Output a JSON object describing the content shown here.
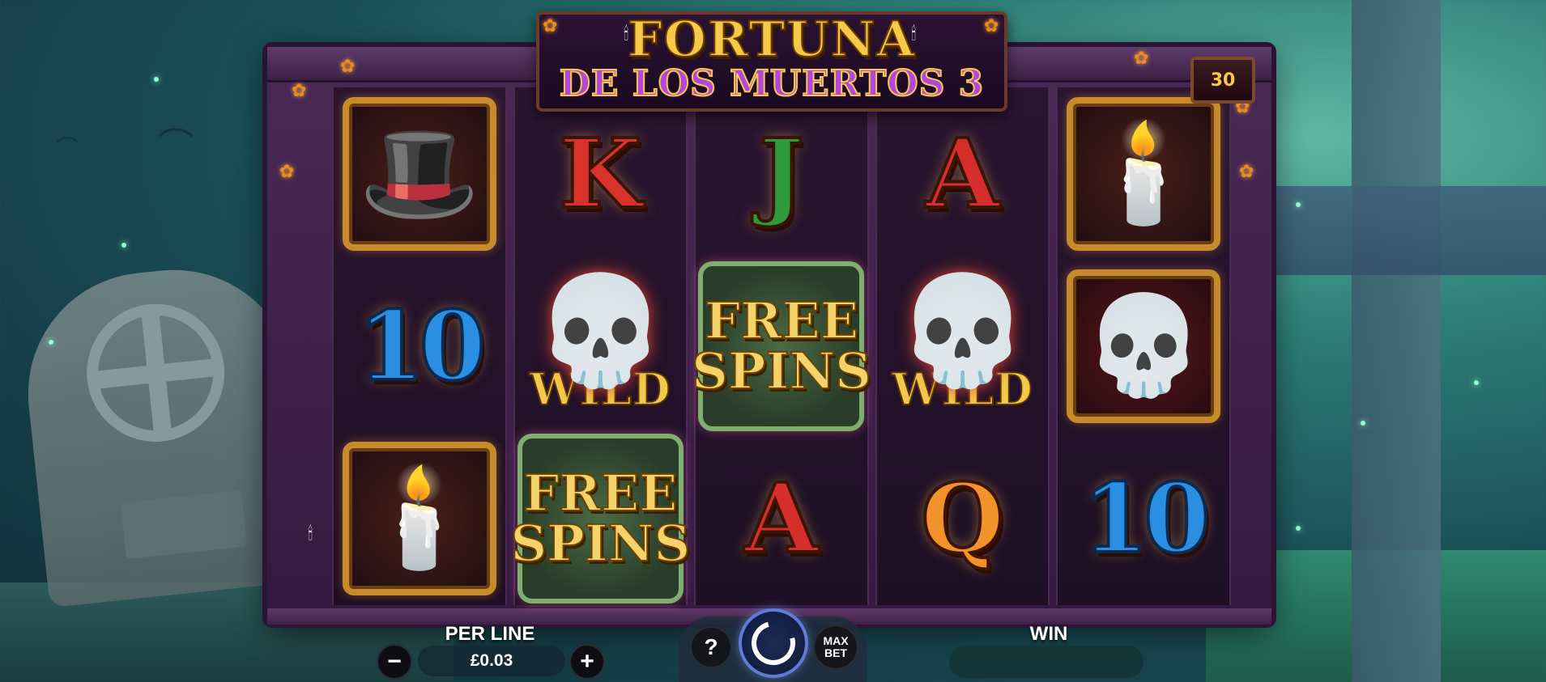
{
  "game": {
    "title_line1": "FORTUNA",
    "title_line2": "DE LOS MUERTOS 3",
    "lines_count": "30"
  },
  "reels": [
    {
      "symbols": [
        {
          "kind": "framed",
          "name": "sombrero",
          "glyph": "🎩"
        },
        {
          "kind": "letter",
          "name": "10",
          "label": "10",
          "style": "sym-10"
        },
        {
          "kind": "framed",
          "name": "candles",
          "glyph": "🕯️"
        }
      ]
    },
    {
      "symbols": [
        {
          "kind": "letter",
          "name": "k",
          "label": "K",
          "style": "sym-k"
        },
        {
          "kind": "wild",
          "name": "wild",
          "glyph": "💀",
          "label": "WILD"
        },
        {
          "kind": "free",
          "name": "free-spins",
          "line1": "FREE",
          "line2": "SPINS"
        }
      ]
    },
    {
      "symbols": [
        {
          "kind": "letter",
          "name": "j",
          "label": "J",
          "style": "sym-j"
        },
        {
          "kind": "free",
          "name": "free-spins",
          "line1": "FREE",
          "line2": "SPINS"
        },
        {
          "kind": "letter",
          "name": "a",
          "label": "A",
          "style": "sym-a"
        }
      ]
    },
    {
      "symbols": [
        {
          "kind": "letter",
          "name": "a",
          "label": "A",
          "style": "sym-a"
        },
        {
          "kind": "wild",
          "name": "wild",
          "glyph": "💀",
          "label": "WILD"
        },
        {
          "kind": "letter",
          "name": "q",
          "label": "Q",
          "style": "sym-q"
        }
      ]
    },
    {
      "symbols": [
        {
          "kind": "framed",
          "name": "candles",
          "glyph": "🕯️"
        },
        {
          "kind": "framed",
          "name": "sugar-skull",
          "glyph": "💀"
        },
        {
          "kind": "letter",
          "name": "10",
          "label": "10",
          "style": "sym-10"
        }
      ]
    }
  ],
  "controls": {
    "per_line_label": "PER LINE",
    "stake_value": "£0.03",
    "minus_label": "−",
    "plus_label": "+",
    "help_label": "?",
    "max_bet_line1": "MAX",
    "max_bet_line2": "BET",
    "win_label": "WIN",
    "win_value": ""
  },
  "colors": {
    "accent_gold": "#f7c948",
    "title_purple": "#b147e0",
    "spin_blue": "#5f7bd6"
  }
}
